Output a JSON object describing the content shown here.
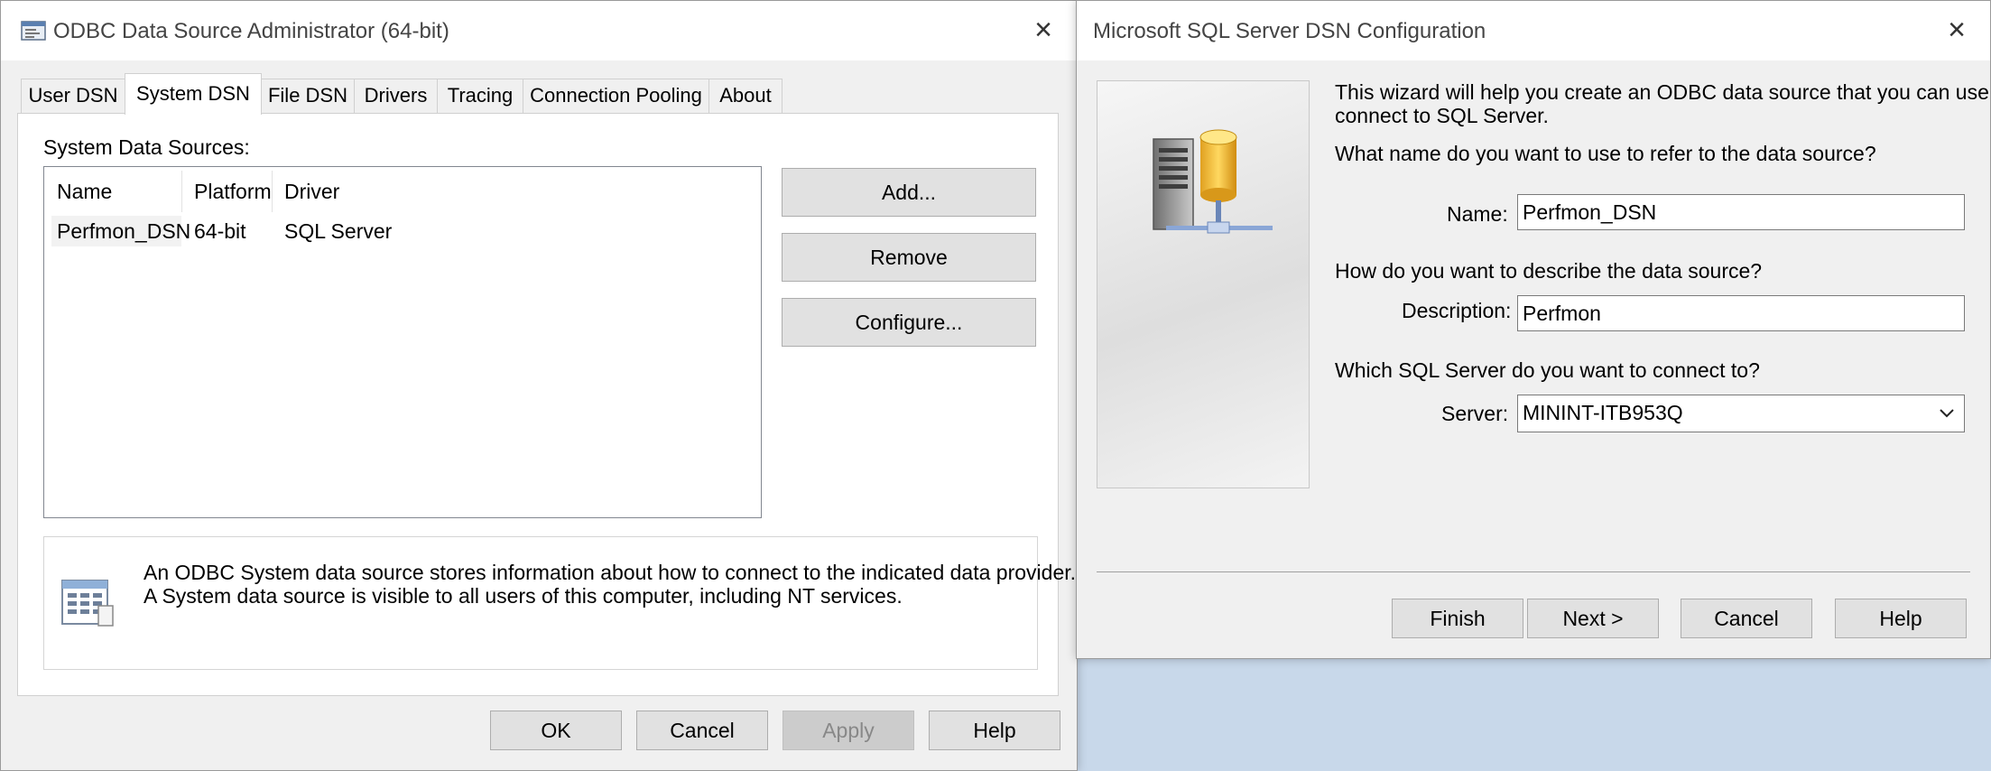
{
  "odbc": {
    "title": "ODBC Data Source Administrator (64-bit)",
    "tabs": [
      "User DSN",
      "System DSN",
      "File DSN",
      "Drivers",
      "Tracing",
      "Connection Pooling",
      "About"
    ],
    "active_tab": "System DSN",
    "list_label": "System Data Sources:",
    "columns": [
      "Name",
      "Platform",
      "Driver"
    ],
    "rows": [
      {
        "name": "Perfmon_DSN",
        "platform": "64-bit",
        "driver": "SQL Server"
      }
    ],
    "side_buttons": {
      "add": "Add...",
      "remove": "Remove",
      "configure": "Configure..."
    },
    "info_line1": "An ODBC System data source stores information about how to connect to the indicated data provider.",
    "info_line2": "A System data source is visible to all users of this computer, including NT services.",
    "footer_buttons": {
      "ok": "OK",
      "cancel": "Cancel",
      "apply": "Apply",
      "help": "Help"
    },
    "icons": {
      "app": "odbc-app-icon",
      "info": "data-source-info-icon",
      "close": "close-icon"
    }
  },
  "dsn_config": {
    "title": "Microsoft SQL Server DSN Configuration",
    "intro_line1": "This wizard will help you create an ODBC data source that you can use to",
    "intro_line2": "connect to SQL Server.",
    "name_question": "What name do you want to use to refer to the data source?",
    "name_label": "Name:",
    "name_value": "Perfmon_DSN",
    "desc_question": "How do you want to describe the data source?",
    "desc_label": "Description:",
    "desc_value": "Perfmon",
    "server_question": "Which SQL Server do you want to connect to?",
    "server_label": "Server:",
    "server_value": "MININT-ITB953Q",
    "buttons": {
      "finish": "Finish",
      "next": "Next >",
      "cancel": "Cancel",
      "help": "Help"
    },
    "icons": {
      "graphic": "database-server-icon",
      "dropdown": "chevron-down-icon",
      "close": "close-icon"
    }
  },
  "colors": {
    "window_bg": "#f0f0f0",
    "desktop": "#c8d8ea",
    "button": "#e1e1e1"
  }
}
